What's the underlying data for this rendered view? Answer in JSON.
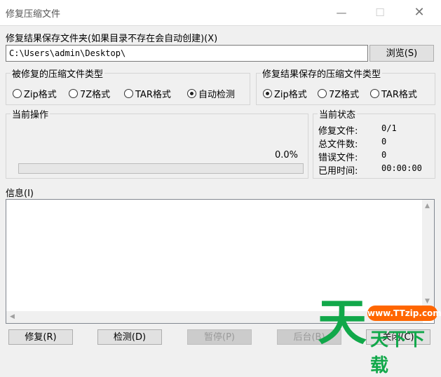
{
  "window": {
    "title": "修复压缩文件",
    "min_icon": "minimize-icon",
    "max_icon": "maximize-icon",
    "close_icon": "close-icon"
  },
  "output": {
    "label": "修复结果保存文件夹(如果目录不存在会自动创建)(X)",
    "path_value": "C:\\Users\\admin\\Desktop\\",
    "browse_label": "浏览(S)"
  },
  "source_type": {
    "title": "被修复的压缩文件类型",
    "options": [
      "Zip格式",
      "7Z格式",
      "TAR格式",
      "自动检测"
    ],
    "selected": "自动检测"
  },
  "result_type": {
    "title": "修复结果保存的压缩文件类型",
    "options": [
      "Zip格式",
      "7Z格式",
      "TAR格式"
    ],
    "selected": "Zip格式"
  },
  "current_op": {
    "title": "当前操作",
    "percent_text": "0.0%",
    "progress_fraction": 0.0
  },
  "current_status": {
    "title": "当前状态",
    "rows": [
      {
        "key": "修复文件:",
        "value": "0/1"
      },
      {
        "key": "总文件数:",
        "value": "0"
      },
      {
        "key": "错误文件:",
        "value": "0"
      },
      {
        "key": "已用时间:",
        "value": "00:00:00"
      }
    ]
  },
  "info": {
    "label": "信息(I)",
    "content": ""
  },
  "buttons": {
    "repair": "修复(R)",
    "detect": "检测(D)",
    "pause": "暂停(P)",
    "background": "后台(B)",
    "close": "关闭(C)"
  },
  "watermark": {
    "site": "www.TTzip.com",
    "big": "天",
    "small": "天下下载"
  },
  "colors": {
    "watermark_green": "#11a84a",
    "watermark_orange": "#ff6600",
    "progress_green": "#06b025"
  }
}
